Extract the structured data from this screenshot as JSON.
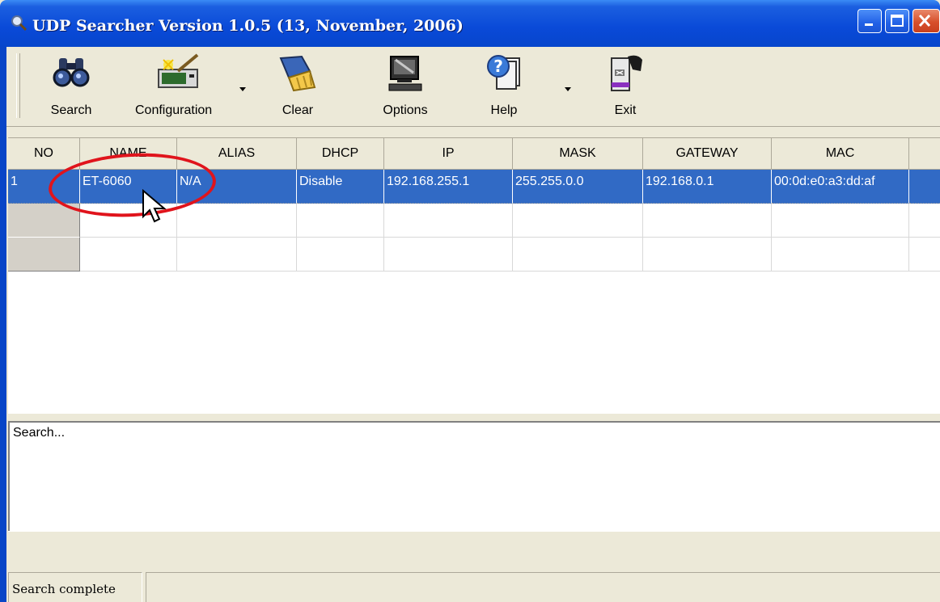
{
  "window": {
    "title": "UDP Searcher Version 1.0.5 (13, November, 2006)"
  },
  "toolbar": {
    "items": [
      {
        "label": "Search",
        "icon": "binoculars-icon"
      },
      {
        "label": "Configuration",
        "icon": "configuration-icon"
      },
      {
        "label": "Clear",
        "icon": "broom-icon"
      },
      {
        "label": "Options",
        "icon": "computer-icon"
      },
      {
        "label": "Help",
        "icon": "help-icon"
      },
      {
        "label": "Exit",
        "icon": "exit-door-icon"
      }
    ]
  },
  "grid": {
    "columns": [
      "NO",
      "NAME",
      "ALIAS",
      "DHCP",
      "IP",
      "MASK",
      "GATEWAY",
      "MAC"
    ],
    "rows": [
      [
        "1",
        "ET-6060",
        "N/A",
        "Disable",
        "192.168.255.1",
        "255.255.0.0",
        "192.168.0.1",
        "00:0d:e0:a3:dd:af"
      ]
    ]
  },
  "log": {
    "text": "Search..."
  },
  "statusbar": {
    "text": "Search complete"
  },
  "colors": {
    "selection": "#316ac5",
    "title_bar": "#0a4ad8",
    "annotation": "#e0141c"
  }
}
